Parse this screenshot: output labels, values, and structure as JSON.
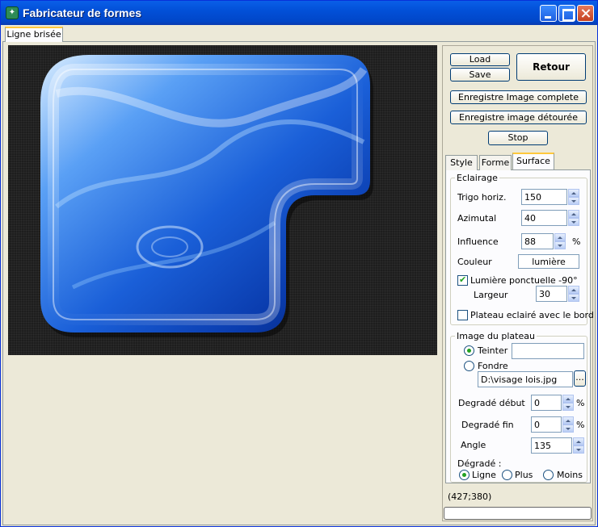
{
  "window": {
    "title": "Fabricateur de formes"
  },
  "outer_tab": {
    "label": "Ligne brisée"
  },
  "buttons": {
    "load": "Load",
    "save": "Save",
    "retour": "Retour",
    "enreg_complete": "Enregistre Image complete",
    "enreg_detouree": "Enregistre image détourée",
    "stop": "Stop"
  },
  "inner_tabs": [
    {
      "label": "Style",
      "active": false
    },
    {
      "label": "Forme",
      "active": false
    },
    {
      "label": "Surface",
      "active": true
    }
  ],
  "eclairage": {
    "title": "Eclairage",
    "trigo_label": "Trigo horiz.",
    "trigo_value": "150",
    "azimutal_label": "Azimutal",
    "azimutal_value": "40",
    "influence_label": "Influence",
    "influence_value": "88",
    "influence_unit": "%",
    "couleur_label": "Couleur",
    "couleur_button": "lumière",
    "lumiere_ponctuelle_label": "Lumière ponctuelle -90°",
    "lumiere_ponctuelle_checked": true,
    "largeur_label": "Largeur",
    "largeur_value": "30",
    "plateau_eclaire_label": "Plateau eclairé avec le bord",
    "plateau_eclaire_checked": false
  },
  "plateau": {
    "title": "Image du plateau",
    "teinter_label": "Teinter",
    "teinter_selected": true,
    "teinter_value": "",
    "fondre_label": "Fondre",
    "fondre_selected": false,
    "file_path": "D:\\visage lois.jpg",
    "browse_label": "...",
    "degrade_debut_label": "Degradé début",
    "degrade_debut_value": "0",
    "degrade_fin_label": "Degradé fin",
    "degrade_fin_value": "0",
    "percent": "%",
    "angle_label": "Angle",
    "angle_value": "135",
    "degrade_title": "Dégradé :",
    "options": [
      {
        "label": "Ligne",
        "selected": true
      },
      {
        "label": "Plus",
        "selected": false
      },
      {
        "label": "Moins",
        "selected": false
      }
    ]
  },
  "status": {
    "coords": "(427;380)"
  },
  "colors": {
    "accent": "#ffc83c",
    "titlebar": "#0250d8",
    "shape_blue": "#1a5fd8"
  }
}
